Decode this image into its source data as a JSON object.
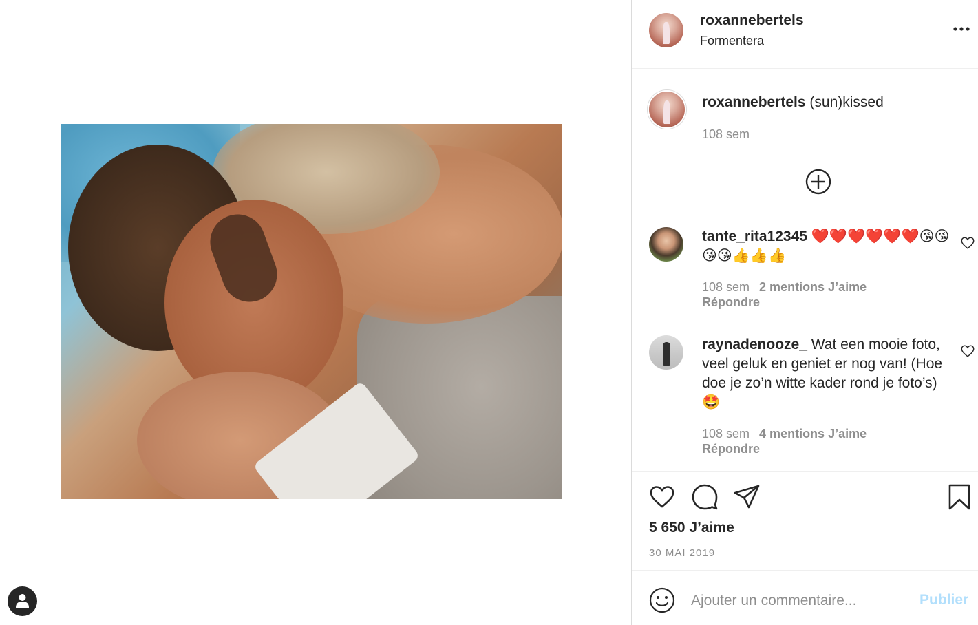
{
  "post": {
    "username": "roxannebertels",
    "location": "Formentera",
    "caption_user": "roxannebertels",
    "caption_text": "(sun)kissed",
    "caption_time": "108 sem"
  },
  "comments": [
    {
      "user": "tante_rita12345",
      "text": "❤️❤️❤️❤️❤️❤️😘😘😘😘👍👍👍",
      "time": "108 sem",
      "likes": "2 mentions J’aime",
      "reply": "Répondre"
    },
    {
      "user": "raynadenooze_",
      "text": "Wat een mooie foto, veel geluk en geniet er nog van! (Hoe doe je zo’n witte kader rond je foto’s) 🤩",
      "time": "108 sem",
      "likes": "4 mentions J’aime",
      "reply": "Répondre"
    }
  ],
  "footer": {
    "likes": "5 650 J’aime",
    "date": "30 MAI 2019",
    "comment_placeholder": "Ajouter un commentaire...",
    "post_label": "Publier"
  },
  "colors": {
    "text": "#262626",
    "muted": "#8e8e8e",
    "post_disabled": "#b2dffc",
    "border": "#dbdbdb"
  },
  "icons": [
    "more-icon",
    "add-circle-icon",
    "heart-icon",
    "comment-icon",
    "share-icon",
    "bookmark-icon",
    "emoji-icon",
    "profile-icon"
  ]
}
